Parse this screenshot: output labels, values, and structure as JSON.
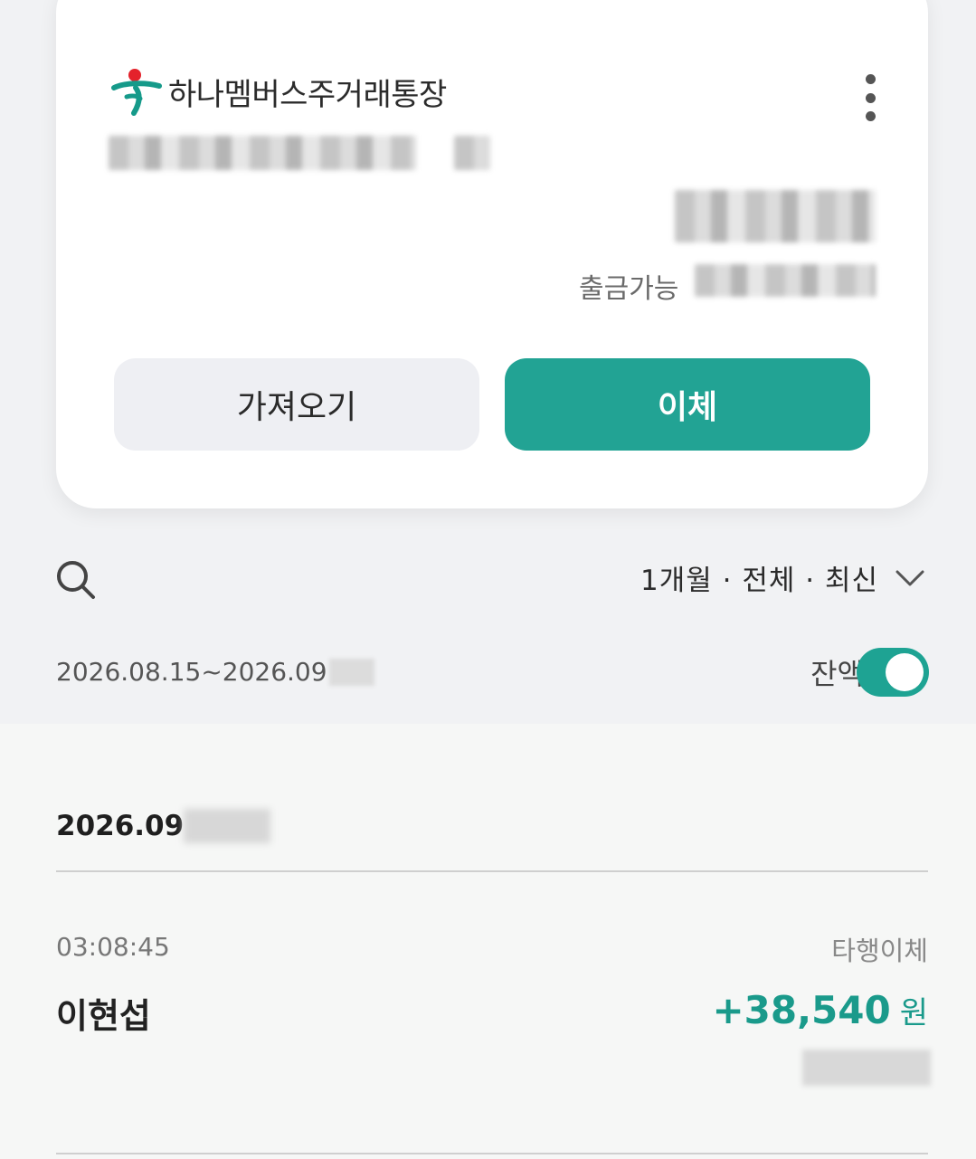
{
  "account": {
    "name": "하나멤버스주거래통장",
    "withdrawable_label": "출금가능"
  },
  "actions": {
    "import_label": "가져오기",
    "transfer_label": "이체"
  },
  "filter": {
    "label": "1개월 · 전체 · 최신"
  },
  "period": {
    "range_text": "2026.08.15~2026.09",
    "balance_toggle_label": "잔액",
    "balance_toggle_on": true
  },
  "transactions": {
    "date_header": "2026.09",
    "items": [
      {
        "time": "03:08:45",
        "type": "타행이체",
        "name": "이현섭",
        "amount": "+38,540",
        "unit": "원"
      }
    ]
  },
  "colors": {
    "accent": "#22a394",
    "amount": "#1a9a8b",
    "background": "#f1f2f4"
  },
  "icons": [
    "hana-logo-icon",
    "more-vertical-icon",
    "search-icon",
    "chevron-down-icon"
  ]
}
